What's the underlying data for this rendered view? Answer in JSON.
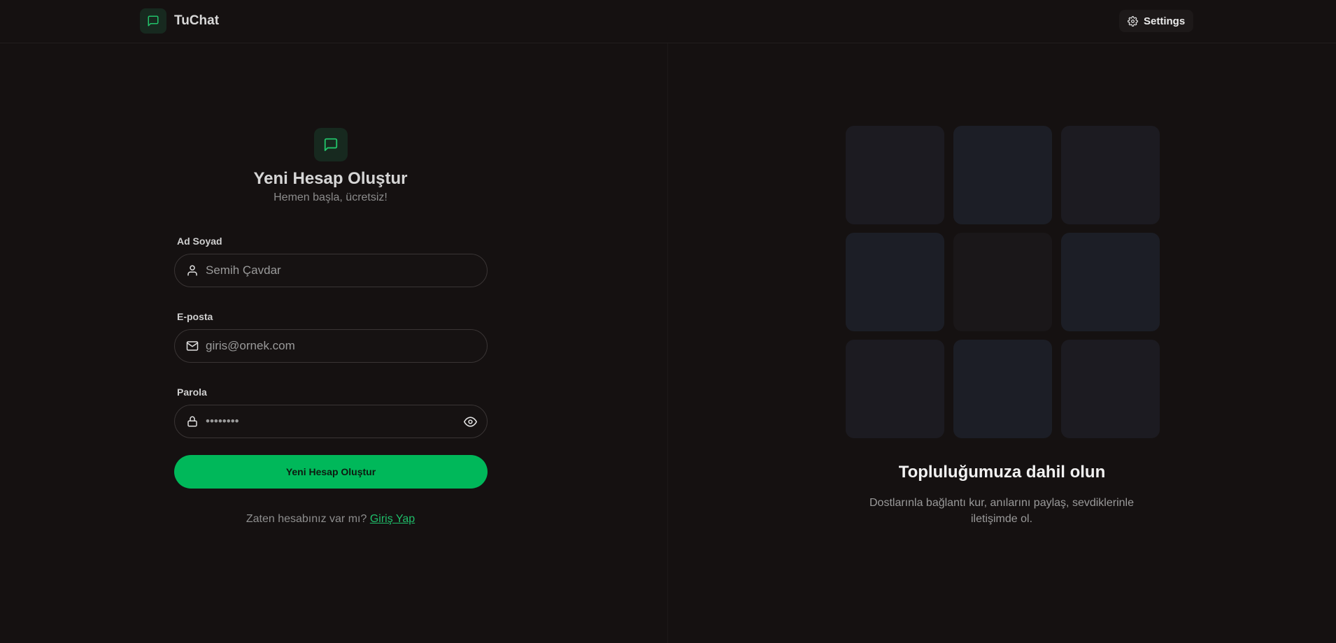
{
  "header": {
    "app_name": "TuChat",
    "logo_icon": "message-square-icon",
    "settings_label": "Settings",
    "settings_icon": "gear-icon"
  },
  "form": {
    "icon": "message-square-icon",
    "title": "Yeni Hesap Oluştur",
    "subtitle": "Hemen başla, ücretsiz!",
    "fields": {
      "name": {
        "label": "Ad Soyad",
        "placeholder": "Semih Çavdar",
        "value": "",
        "icon": "user-icon"
      },
      "email": {
        "label": "E-posta",
        "placeholder": "giris@ornek.com",
        "value": "",
        "icon": "mail-icon"
      },
      "password": {
        "label": "Parola",
        "placeholder": "••••••••",
        "value": "",
        "icon": "lock-icon",
        "toggle_icon": "eye-icon"
      }
    },
    "submit_label": "Yeni Hesap Oluştur",
    "login_prompt": "Zaten hesabınız var mı?",
    "login_link": "Giriş Yap"
  },
  "promo": {
    "title": "Topluluğumuza dahil olun",
    "text": "Dostlarınla bağlantı kur, anılarını paylaş, sevdiklerinle iletişimde ol."
  },
  "colors": {
    "accent": "#00b85a",
    "background": "#151111",
    "icon_bg": "#17291f"
  }
}
